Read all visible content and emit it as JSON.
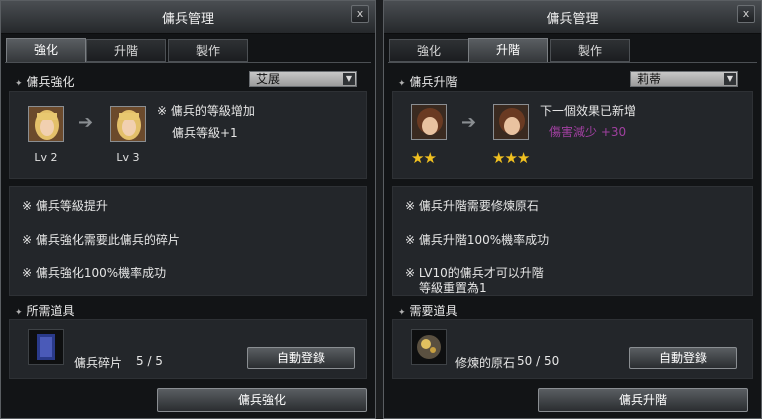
{
  "left": {
    "title": "傭兵管理",
    "close": "x",
    "tabs": [
      "強化",
      "升階",
      "製作"
    ],
    "section_label": "傭兵強化",
    "dropdown": "艾展",
    "from_level": "Lv 2",
    "to_level": "Lv 3",
    "effect_title": "※ 傭兵的等級增加",
    "effect_value": "傭兵等級+1",
    "notes": [
      "※ 傭兵等級提升",
      "※ 傭兵強化需要此傭兵的碎片",
      "※ 傭兵強化100%機率成功"
    ],
    "items_label": "所需道具",
    "item_name": "傭兵碎片",
    "item_count": "5 / 5",
    "auto_button": "自動登錄",
    "action_button": "傭兵強化"
  },
  "right": {
    "title": "傭兵管理",
    "close": "x",
    "tabs": [
      "強化",
      "升階",
      "製作"
    ],
    "section_label": "傭兵升階",
    "dropdown": "莉蒂",
    "from_stars": "★★",
    "to_stars": "★★★",
    "effect_title": "下一個效果已新增",
    "effect_value": "傷害減少 +30",
    "notes": [
      "※ 傭兵升階需要修煉原石",
      "※ 傭兵升階100%機率成功",
      "※ LV10的傭兵才可以升階",
      "等級重置為1"
    ],
    "items_label": "需要道具",
    "item_name": "修煉的原石",
    "item_count": "50 / 50",
    "auto_button": "自動登錄",
    "action_button": "傭兵升階"
  },
  "colors": {
    "effect_value_right": "#a040a0",
    "star": "#f0c020"
  }
}
